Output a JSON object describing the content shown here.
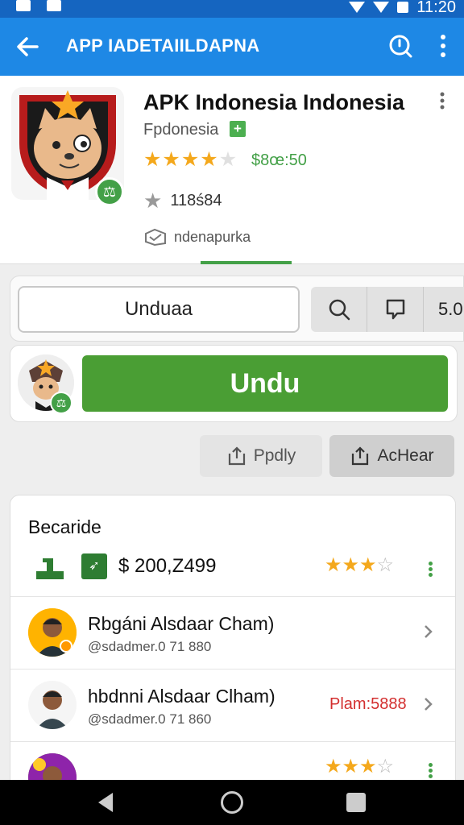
{
  "status_bar": {
    "time": "11:20"
  },
  "app_bar": {
    "title": "APP IADETAIILDAPNA"
  },
  "app": {
    "name": "APK Indonesia Indonesia",
    "developer": "Fpdonesia",
    "developer_badge": "+",
    "rating_stars": 4,
    "price": "$8œ:50",
    "downloads": "118ś84",
    "category": "ndenapurka",
    "icon_badge": "⚖"
  },
  "actions": {
    "field_label": "Unduaa",
    "version_text": "5.0",
    "install_label": "Undu",
    "chip_left": "Ppdly",
    "chip_right": "AcHear"
  },
  "list": {
    "title": "Becaride",
    "price_row": {
      "price": "$ 200,Z499",
      "stars": 2.5
    },
    "users": [
      {
        "name": "Rbgáni Alsdaar Cham)",
        "handle": "@sdadmer.0 71 880",
        "plan": ""
      },
      {
        "name": "hbdnni Alsdaar Clham)",
        "handle": "@sdadmer.0 71 860",
        "plan": "Plam:5888"
      }
    ],
    "partial_row_stars": 2.5
  },
  "colors": {
    "primary": "#1e88e5",
    "status_bar": "#1565c0",
    "accent_green": "#4a9e34",
    "star": "#f4a81c",
    "plan_red": "#d32f2f"
  },
  "icons": [
    "back-arrow-icon",
    "search-icon",
    "more-vert-icon",
    "star-icon",
    "category-icon",
    "bookmark-icon",
    "share-icon",
    "chevron-right-icon"
  ]
}
